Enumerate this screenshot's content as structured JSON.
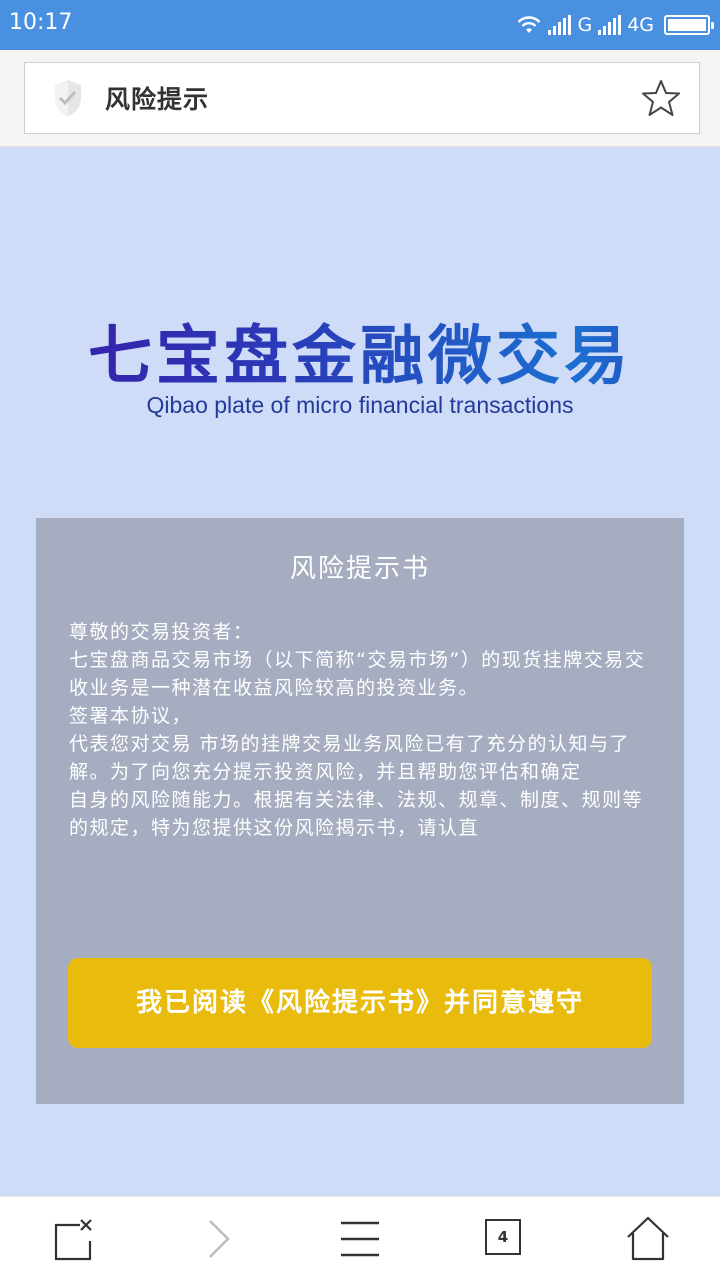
{
  "status_bar": {
    "time": "10:17",
    "network1": "G",
    "network2": "4G"
  },
  "address_bar": {
    "title": "风险提示"
  },
  "logo": {
    "chinese": "七宝盘金融微交易",
    "english": "Qibao plate of micro financial transactions"
  },
  "card": {
    "heading": "风险提示书",
    "paragraphs": [
      "尊敬的交易投资者：",
      "七宝盘商品交易市场（以下简称“交易市场”）的现货挂牌交易交收业务是一种潜在收益风险较高的投资业务。",
      "签署本协议，",
      "代表您对交易 市场的挂牌交易业务风险已有了充分的认知与了解。为了向您充分提示投资风险，并且帮助您评估和确定",
      "自身的风险随能力。根据有关法律、法规、规章、制度、规则等的规定，特为您提供这份风险揭示书，请认直"
    ],
    "agree_button": "我已阅读《风险提示书》并同意遵守"
  },
  "bottom_nav": {
    "tab_count": "4"
  },
  "colors": {
    "status_bar": "#4a90e0",
    "background": "#cfdcf8",
    "card": "#a6adc0",
    "agree_button": "#e8bb0c"
  }
}
